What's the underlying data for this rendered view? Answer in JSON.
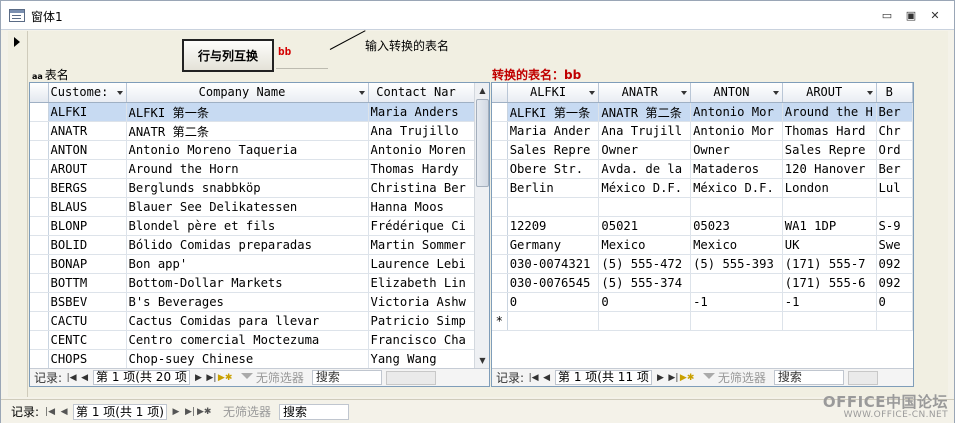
{
  "window": {
    "title": "窗体1",
    "min_glyph": "▭",
    "restore_glyph": "▣",
    "close_glyph": "✕"
  },
  "form": {
    "swap_button_label": "行与列互换",
    "input_value": "bb",
    "hint": "输入转换的表名",
    "table_label_prefix": "aa",
    "table_label": "表名",
    "result_label": "转换的表名：bb"
  },
  "left_grid": {
    "columns": [
      "Custome:",
      "Company Name",
      "Contact Nar"
    ],
    "rows": [
      [
        "ALFKI",
        "ALFKI 第一条",
        "Maria Anders"
      ],
      [
        "ANATR",
        "ANATR 第二条",
        "Ana Trujillo"
      ],
      [
        "ANTON",
        "Antonio Moreno Taqueria",
        "Antonio Moren"
      ],
      [
        "AROUT",
        "Around the Horn",
        "Thomas Hardy"
      ],
      [
        "BERGS",
        "Berglunds snabbköp",
        "Christina Ber"
      ],
      [
        "BLAUS",
        "Blauer See Delikatessen",
        "Hanna Moos"
      ],
      [
        "BLONP",
        "Blondel père et fils",
        "Frédérique Ci"
      ],
      [
        "BOLID",
        "Bólido Comidas preparadas",
        "Martin Sommer"
      ],
      [
        "BONAP",
        "Bon app'",
        "Laurence Lebi"
      ],
      [
        "BOTTM",
        "Bottom-Dollar Markets",
        "Elizabeth Lin"
      ],
      [
        "BSBEV",
        "B's Beverages",
        "Victoria Ashw"
      ],
      [
        "CACTU",
        "Cactus Comidas para llevar",
        "Patricio Simp"
      ],
      [
        "CENTC",
        "Centro comercial Moctezuma",
        "Francisco Cha"
      ],
      [
        "CHOPS",
        "Chop-suey Chinese",
        "Yang Wang"
      ]
    ],
    "nav": {
      "label": "记录:",
      "position": "第 1 项(共 20 项",
      "no_filter": "无筛选器",
      "search": "搜索"
    }
  },
  "right_grid": {
    "columns": [
      "ALFKI",
      "ANATR",
      "ANTON",
      "AROUT",
      "B"
    ],
    "rows": [
      [
        "ALFKI 第一条",
        "ANATR 第二条",
        "Antonio Mor",
        "Around the H",
        "Ber"
      ],
      [
        "Maria Ander",
        "Ana Trujill",
        "Antonio Mor",
        "Thomas Hard",
        "Chr"
      ],
      [
        "Sales Repre",
        "Owner",
        "Owner",
        "Sales Repre",
        "Ord"
      ],
      [
        "Obere Str.",
        "Avda. de la",
        "Mataderos",
        "120 Hanover",
        "Ber"
      ],
      [
        "Berlin",
        "México D.F.",
        "México D.F.",
        "London",
        "Lul"
      ],
      [
        "",
        "",
        "",
        "",
        ""
      ],
      [
        "12209",
        "05021",
        "05023",
        "WA1 1DP",
        "S-9"
      ],
      [
        "Germany",
        "Mexico",
        "Mexico",
        "UK",
        "Swe"
      ],
      [
        "030-0074321",
        "(5) 555-472",
        "(5) 555-393",
        "(171) 555-7",
        "092"
      ],
      [
        "030-0076545",
        "(5) 555-374",
        "",
        "(171) 555-6",
        "092"
      ],
      [
        "0",
        "0",
        "-1",
        "-1",
        "0"
      ]
    ],
    "new_row_marker": "*",
    "nav": {
      "label": "记录:",
      "position": "第 1 项(共 11 项",
      "no_filter": "无筛选器",
      "search": "搜索"
    }
  },
  "bottom_nav": {
    "label": "记录:",
    "position": "第 1 项(共 1 项)",
    "no_filter": "无筛选器",
    "search": "搜索"
  },
  "watermark": {
    "main": "OFFICE中国论坛",
    "sub": "WWW.OFFICE-CN.NET"
  }
}
